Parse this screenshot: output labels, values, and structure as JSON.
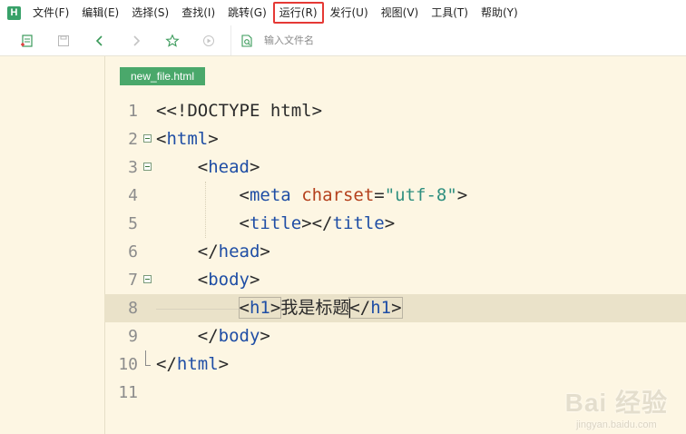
{
  "app": {
    "logo_letter": "H"
  },
  "menu": [
    {
      "label": "文件(F)"
    },
    {
      "label": "编辑(E)"
    },
    {
      "label": "选择(S)"
    },
    {
      "label": "查找(I)"
    },
    {
      "label": "跳转(G)"
    },
    {
      "label": "运行(R)",
      "highlighted": true
    },
    {
      "label": "发行(U)"
    },
    {
      "label": "视图(V)"
    },
    {
      "label": "工具(T)"
    },
    {
      "label": "帮助(Y)"
    }
  ],
  "toolbar": {
    "icons": [
      "new-file-icon",
      "save-icon",
      "back-icon",
      "forward-icon",
      "favorite-star-icon",
      "run-icon",
      "file-search-icon"
    ],
    "file_search_placeholder": "输入文件名"
  },
  "editor": {
    "tab_label": "new_file.html",
    "current_line": 8,
    "lines": [
      {
        "n": "1"
      },
      {
        "n": "2"
      },
      {
        "n": "3"
      },
      {
        "n": "4"
      },
      {
        "n": "5"
      },
      {
        "n": "6"
      },
      {
        "n": "7"
      },
      {
        "n": "8"
      },
      {
        "n": "9"
      },
      {
        "n": "10"
      },
      {
        "n": "11"
      }
    ],
    "code": {
      "doctype": "<!DOCTYPE html>",
      "html": "html",
      "head": "head",
      "meta": "meta",
      "charset_attr": "charset",
      "charset_val": "\"utf-8\"",
      "title": "title",
      "body": "body",
      "h1": "h1",
      "h1_text": "我是标题"
    }
  },
  "colors": {
    "accent": "#4aa86b",
    "editor_bg": "#fdf6e3",
    "current_line_bg": "#eae2c9",
    "tag": "#1f4ea5",
    "attr": "#b4401c",
    "string": "#2f8f7f",
    "highlight_outline": "#e53935"
  },
  "watermark": {
    "main": "Bai 经验",
    "sub": "jingyan.baidu.com"
  }
}
